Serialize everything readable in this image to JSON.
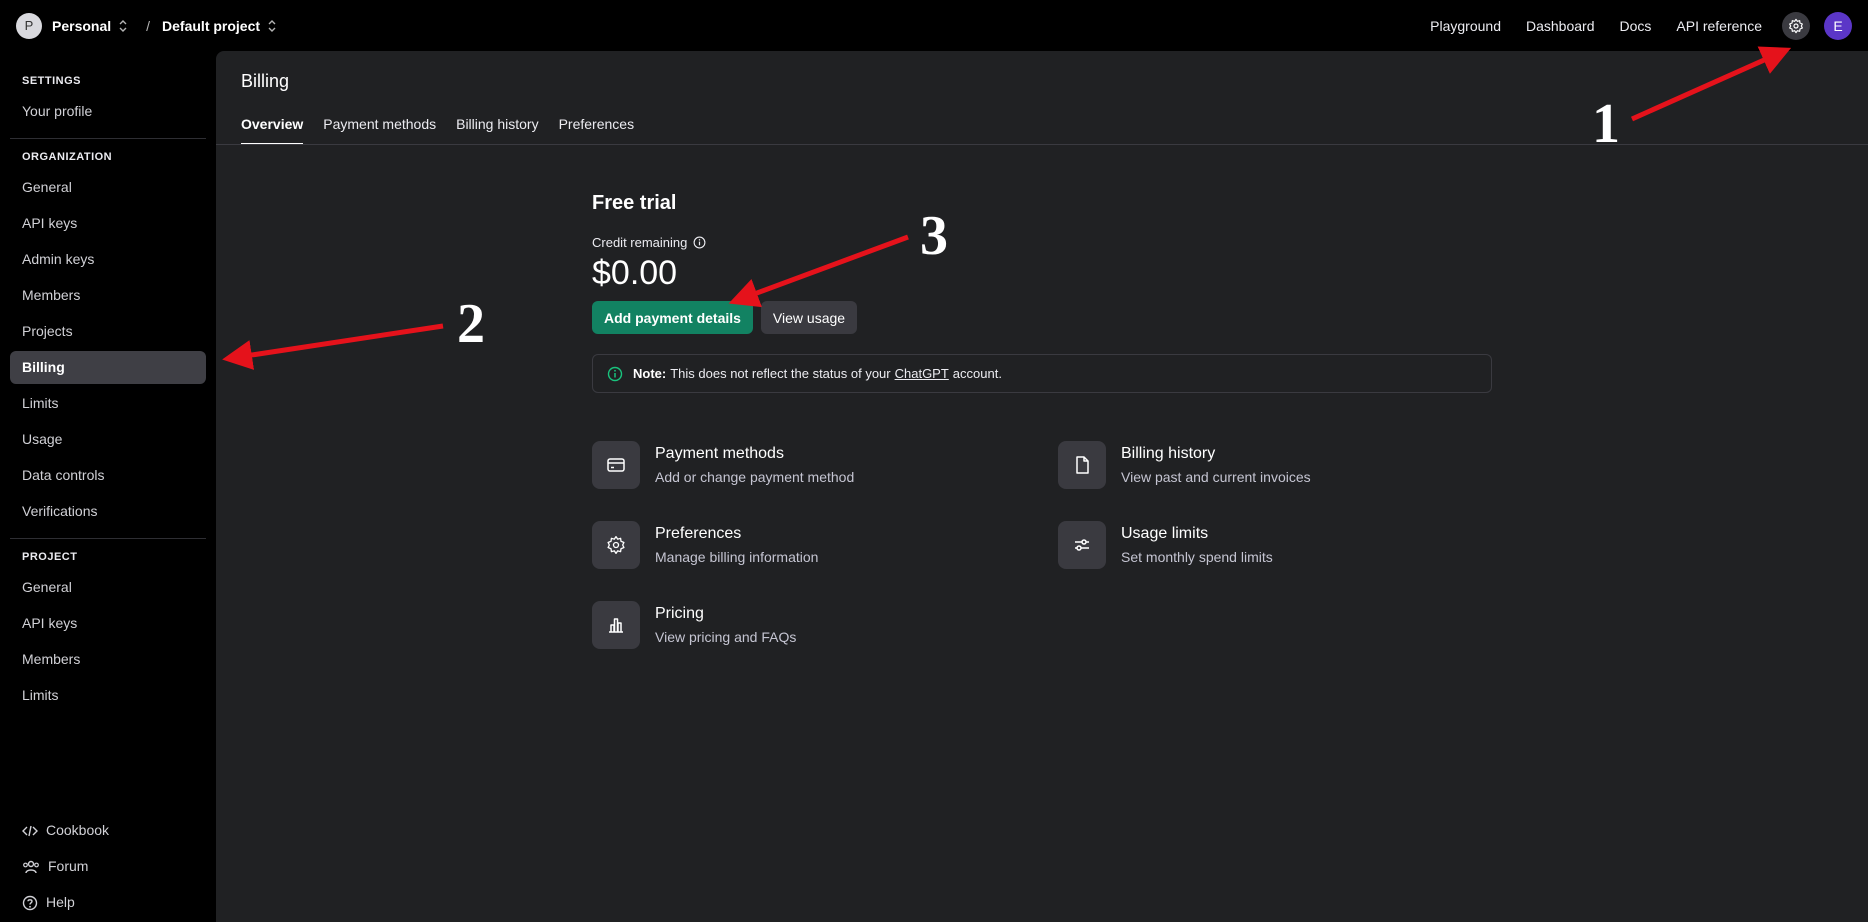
{
  "topbar": {
    "org_initial": "P",
    "org_name": "Personal",
    "separator": "/",
    "project_name": "Default project",
    "nav": [
      "Playground",
      "Dashboard",
      "Docs",
      "API reference"
    ],
    "user_initial": "E"
  },
  "sidebar": {
    "settings_heading": "SETTINGS",
    "settings_items": [
      "Your profile"
    ],
    "organization_heading": "ORGANIZATION",
    "organization_items": [
      "General",
      "API keys",
      "Admin keys",
      "Members",
      "Projects",
      "Billing",
      "Limits",
      "Usage",
      "Data controls",
      "Verifications"
    ],
    "project_heading": "PROJECT",
    "project_items": [
      "General",
      "API keys",
      "Members",
      "Limits"
    ],
    "footer_items": [
      "Cookbook",
      "Forum",
      "Help"
    ]
  },
  "main": {
    "title": "Billing",
    "tabs": [
      "Overview",
      "Payment methods",
      "Billing history",
      "Preferences"
    ],
    "plan": "Free trial",
    "credit_label": "Credit remaining",
    "credit_value": "$0.00",
    "primary_button": "Add payment details",
    "secondary_button": "View usage",
    "note": {
      "prefix": "Note:",
      "text_before": "This does not reflect the status of your",
      "link": "ChatGPT",
      "text_after": "account."
    },
    "cards": [
      {
        "title": "Payment methods",
        "subtitle": "Add or change payment method",
        "icon": "credit-card-icon"
      },
      {
        "title": "Billing history",
        "subtitle": "View past and current invoices",
        "icon": "document-icon"
      },
      {
        "title": "Preferences",
        "subtitle": "Manage billing information",
        "icon": "gear-icon"
      },
      {
        "title": "Usage limits",
        "subtitle": "Set monthly spend limits",
        "icon": "sliders-icon"
      },
      {
        "title": "Pricing",
        "subtitle": "View pricing and FAQs",
        "icon": "bar-chart-icon"
      }
    ]
  },
  "annotations": {
    "labels": [
      "1",
      "2",
      "3"
    ],
    "arrow_color": "#e5121b"
  },
  "colors": {
    "accent_green": "#128262",
    "panel_bg": "#202123",
    "avatar_purple": "#5b36c7"
  }
}
